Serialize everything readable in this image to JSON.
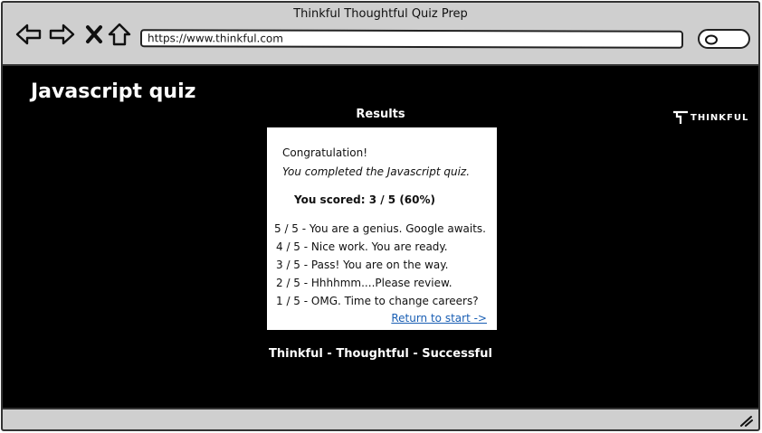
{
  "window": {
    "title": "Thinkful Thoughtful Quiz Prep"
  },
  "toolbar": {
    "url": "https://www.thinkful.com",
    "icons": [
      "back-icon",
      "forward-icon",
      "close-icon",
      "home-icon",
      "search-icon"
    ]
  },
  "page": {
    "heading": "Javascript quiz",
    "logo_text": "THINKFUL",
    "results_label": "Results",
    "tagline": "Thinkful - Thoughtful - Successful"
  },
  "results": {
    "congrats": "Congratulation!",
    "completed": "You completed the Javascript quiz.",
    "score_prefix": "You scored:",
    "score_value": "3 / 5",
    "score_percent": "(60%)",
    "scale": [
      "5 / 5  - You are a genius. Google awaits.",
      "4 / 5 - Nice work. You are ready.",
      "3 / 5 - Pass! You are on the way.",
      "2 / 5 - Hhhhmm....Please review.",
      "1 / 5  - OMG. Time to change careers?"
    ],
    "return_link": "Return to start ->"
  },
  "colors": {
    "chrome": "#cfcfcf",
    "page_background": "#000000",
    "card": "#ffffff",
    "link": "#1a5fb4"
  }
}
